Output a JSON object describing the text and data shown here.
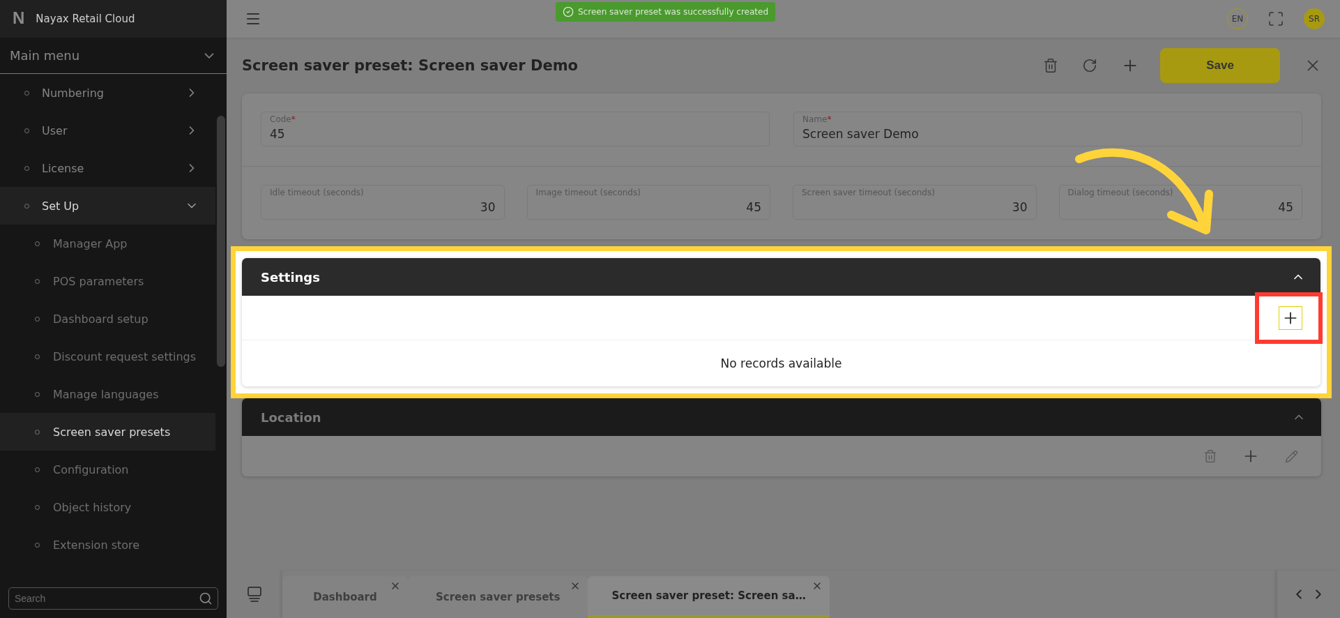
{
  "app": {
    "logo": "N",
    "title": "Nayax Retail Cloud"
  },
  "sidebar": {
    "menu_title": "Main menu",
    "items": [
      {
        "label": "Numbering",
        "expanded": false
      },
      {
        "label": "User",
        "expanded": false
      },
      {
        "label": "License",
        "expanded": false
      },
      {
        "label": "Set Up",
        "expanded": true,
        "children": [
          {
            "label": "Manager App",
            "selected": false
          },
          {
            "label": "POS parameters",
            "selected": false
          },
          {
            "label": "Dashboard setup",
            "selected": false
          },
          {
            "label": "Discount request settings",
            "selected": false
          },
          {
            "label": "Manage languages",
            "selected": false
          },
          {
            "label": "Screen saver presets",
            "selected": true
          },
          {
            "label": "Configuration",
            "selected": false
          },
          {
            "label": "Object history",
            "selected": false
          },
          {
            "label": "Extension store",
            "selected": false
          }
        ]
      }
    ],
    "search": {
      "placeholder": "Search"
    }
  },
  "header": {
    "toast": "Screen saver preset was successfully created",
    "language": "EN",
    "avatar": "SR"
  },
  "page": {
    "title": "Screen saver preset: Screen saver Demo",
    "save": "Save"
  },
  "form": {
    "main_fields": [
      {
        "label": "Code",
        "required_mark": "*",
        "value": "45"
      },
      {
        "label": "Name",
        "required_mark": "*",
        "value": "Screen saver Demo"
      }
    ],
    "timeout_fields": [
      {
        "label": "Idle timeout (seconds)",
        "value": "30",
        "kind": "number"
      },
      {
        "label": "Image timeout (seconds)",
        "value": "45",
        "kind": "number"
      },
      {
        "label": "Screen saver timeout (seconds)",
        "value": "30",
        "kind": "number"
      },
      {
        "label": "Dialog timeout (seconds)",
        "value": "45",
        "kind": "number"
      }
    ]
  },
  "sections": [
    {
      "title": "Settings",
      "expanded": true,
      "highlighted": true,
      "empty_text": "No records available",
      "actions": [
        {
          "kind": "add",
          "marked": true
        }
      ]
    },
    {
      "title": "Location",
      "expanded": true,
      "highlighted": false,
      "actions": [
        {
          "kind": "delete",
          "marked": false
        },
        {
          "kind": "add",
          "marked": false
        },
        {
          "kind": "edit",
          "marked": false
        }
      ]
    }
  ],
  "tabs": [
    {
      "label": "Dashboard",
      "selected": false
    },
    {
      "label": "Screen saver presets",
      "selected": false
    },
    {
      "label": "Screen saver preset: Screen sa…",
      "selected": true
    }
  ]
}
